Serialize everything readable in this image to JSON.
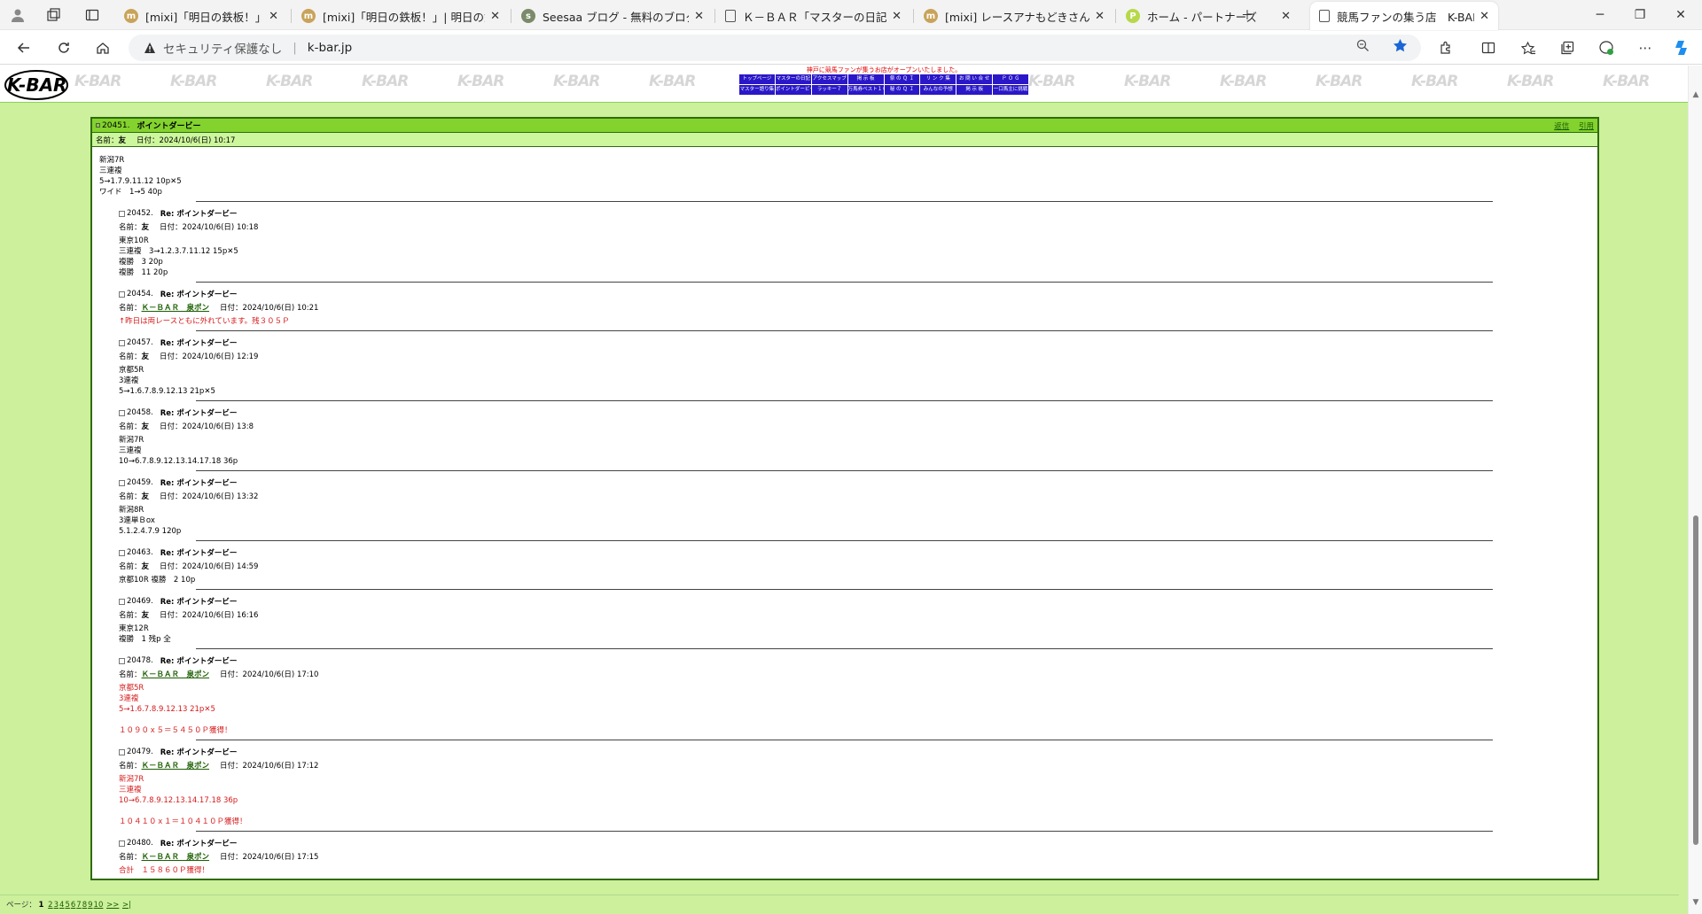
{
  "browser": {
    "tabs": [
      {
        "title": "[mixi]「明日の鉄板！」| 明日の鉄板",
        "fav": "m",
        "color": "#c9a35a"
      },
      {
        "title": "[mixi]「明日の鉄板！」| 明日の鉄板",
        "fav": "m",
        "color": "#c9a35a"
      },
      {
        "title": "Seesaa ブログ - 無料のブログ(blog)",
        "fav": "s",
        "color": "#7a8a6a"
      },
      {
        "title": "Ｋ－ＢＡＲ「マスターの日記」",
        "fav": "",
        "color": "#ffffff"
      },
      {
        "title": "[mixi] レースアナもどきさんとのメッセージ",
        "fav": "m",
        "color": "#c9a35a"
      },
      {
        "title": "ホーム - パートナーズ",
        "fav": "P",
        "color": "#b6d84a"
      },
      {
        "title": "競馬ファンの集う店　K-BAR",
        "fav": "",
        "color": "#ffffff"
      }
    ],
    "address": {
      "security": "セキュリティ保護なし",
      "url": "k-bar.jp"
    }
  },
  "header": {
    "logo_text": "K-BAR",
    "watermark": "K-BAR",
    "notice": "神戸に競馬ファンが集うお店がオープンいたしました。",
    "menu_row1": [
      "トップページ",
      "マスターの日記",
      "アクセスマップ",
      "掲 示 板",
      "祭 の Ｑ Ｉ",
      "リ ン ク 集",
      "お 問 い 合 せ",
      "Ｐ Ｏ Ｇ"
    ],
    "menu_row2": [
      "マスター語り集",
      "ポイントダービー",
      "ラッキー７",
      "万馬券ベスト１０",
      "秘 の Ｑ Ｉ",
      "みんなの予想",
      "掲 示 板",
      "一口馬主に挑戦"
    ]
  },
  "thread": {
    "number": "20451.",
    "title": "ポイントダービー",
    "links": [
      "返信",
      "引用"
    ],
    "name_label": "名前：",
    "name": "友",
    "date_label": "日付：",
    "date": "2024/10/6(日) 10:17",
    "body": "新潟7R\n三連複\n5→1.7.9.11.12 10p✕5\nワイド　1→5 40p"
  },
  "replies": [
    {
      "number": "20452.",
      "title": "Re: ポイントダービー",
      "name": "友",
      "date": "2024/10/6(日) 10:18",
      "body": "東京10R\n三連複　3→1.2.3.7.11.12 15p✕5\n複勝　3 20p\n複勝　11 20p"
    },
    {
      "number": "20454.",
      "title": "Re: ポイントダービー",
      "name": "Ｋ－ＢＡＲ　泉ポン",
      "name_link": true,
      "date": "2024/10/6(日) 10:21",
      "body": "↑昨日は両レースともに外れています。残３０５Ｐ",
      "red": true
    },
    {
      "number": "20457.",
      "title": "Re: ポイントダービー",
      "name": "友",
      "date": "2024/10/6(日) 12:19",
      "body": "京都5R\n3連複\n5→1.6.7.8.9.12.13 21p✕5"
    },
    {
      "number": "20458.",
      "title": "Re: ポイントダービー",
      "name": "友",
      "date": "2024/10/6(日) 13:8",
      "body": "新潟7R\n三連複\n10→6.7.8.9.12.13.14.17.18 36p"
    },
    {
      "number": "20459.",
      "title": "Re: ポイントダービー",
      "name": "友",
      "date": "2024/10/6(日) 13:32",
      "body": "新潟8R\n3連単Ｂox\n5.1.2.4.7.9 120p"
    },
    {
      "number": "20463.",
      "title": "Re: ポイントダービー",
      "name": "友",
      "date": "2024/10/6(日) 14:59",
      "body": "京都10R 複勝　2 10p"
    },
    {
      "number": "20469.",
      "title": "Re: ポイントダービー",
      "name": "友",
      "date": "2024/10/6(日) 16:16",
      "body": "東京12R\n複勝　1 残p 全"
    },
    {
      "number": "20478.",
      "title": "Re: ポイントダービー",
      "name": "Ｋ－ＢＡＲ　泉ポン",
      "name_link": true,
      "date": "2024/10/6(日) 17:10",
      "body": "京都5R\n3連複\n5→1.6.7.8.9.12.13 21p✕5\n\n１０９０ｘ５＝５４５０Ｐ獲得！",
      "red": true
    },
    {
      "number": "20479.",
      "title": "Re: ポイントダービー",
      "name": "Ｋ－ＢＡＲ　泉ポン",
      "name_link": true,
      "date": "2024/10/6(日) 17:12",
      "body": "新潟7R\n三連複\n10→6.7.8.9.12.13.14.17.18 36p\n\n１０４１０ｘ１＝１０４１０Ｐ獲得！",
      "red": true
    },
    {
      "number": "20480.",
      "title": "Re: ポイントダービー",
      "name": "Ｋ－ＢＡＲ　泉ポン",
      "name_link": true,
      "date": "2024/10/6(日) 17:15",
      "body": "合計　１５８６０Ｐ獲得！",
      "red": true
    }
  ],
  "pager": {
    "label": "ページ：",
    "current": "1",
    "pages": [
      "2",
      "3",
      "4",
      "5",
      "6",
      "7",
      "8",
      "9",
      "10"
    ],
    "next": ">>",
    "last": ">|"
  }
}
